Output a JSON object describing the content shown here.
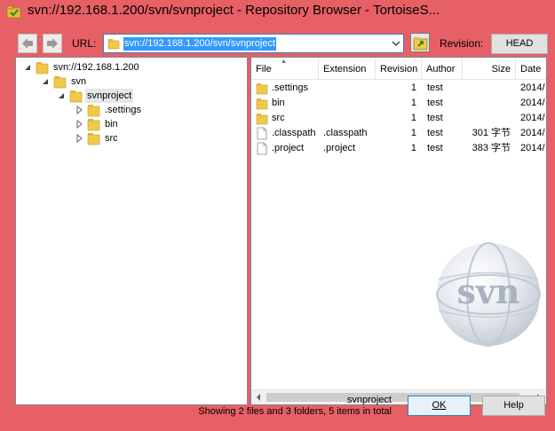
{
  "window": {
    "title": "svn://192.168.1.200/svn/svnproject - Repository Browser - TortoiseS..."
  },
  "toolbar": {
    "url_label": "URL:",
    "url_value": "svn://192.168.1.200/svn/svnproject",
    "revision_label": "Revision:",
    "revision_value": "HEAD"
  },
  "tree": {
    "nodes": [
      {
        "label": "svn://192.168.1.200",
        "expanded": true
      },
      {
        "label": "svn",
        "expanded": true
      },
      {
        "label": "svnproject",
        "expanded": true,
        "selected": true
      },
      {
        "label": ".settings",
        "expanded": false
      },
      {
        "label": "bin",
        "expanded": false
      },
      {
        "label": "src",
        "expanded": false
      }
    ]
  },
  "list": {
    "columns": [
      "File",
      "Extension",
      "Revision",
      "Author",
      "Size",
      "Date"
    ],
    "rows": [
      {
        "icon": "folder-icon",
        "file": ".settings",
        "extension": "",
        "revision": "1",
        "author": "test",
        "size": "",
        "date": "2014/"
      },
      {
        "icon": "folder-icon",
        "file": "bin",
        "extension": "",
        "revision": "1",
        "author": "test",
        "size": "",
        "date": "2014/"
      },
      {
        "icon": "folder-icon",
        "file": "src",
        "extension": "",
        "revision": "1",
        "author": "test",
        "size": "",
        "date": "2014/"
      },
      {
        "icon": "file-icon",
        "file": ".classpath",
        "extension": ".classpath",
        "revision": "1",
        "author": "test",
        "size": "301 字节",
        "date": "2014/"
      },
      {
        "icon": "file-icon",
        "file": ".project",
        "extension": ".project",
        "revision": "1",
        "author": "test",
        "size": "383 字节",
        "date": "2014/"
      }
    ]
  },
  "watermark": {
    "text": "svn"
  },
  "status": {
    "line1": "svnproject",
    "line2": "Showing 2 files and 3 folders, 5 items in total"
  },
  "buttons": {
    "ok": "OK",
    "help": "Help"
  },
  "colors": {
    "window_frame": "#e66066",
    "selection": "#3399ff",
    "folder": "#e8b93a"
  }
}
